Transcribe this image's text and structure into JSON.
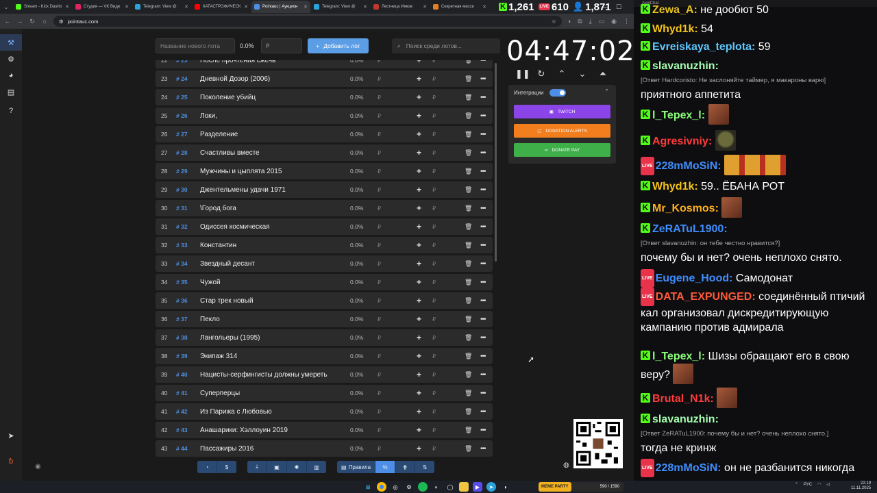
{
  "browser": {
    "tabs": [
      {
        "label": "Stream - Kick Dashb",
        "color": "#53fc18",
        "active": false
      },
      {
        "label": "Студия — VK Виде",
        "color": "#e0245e",
        "active": false
      },
      {
        "label": "Telegram: View @",
        "color": "#2aa3dc",
        "active": false
      },
      {
        "label": "КАТАСТРОФИЧЕСК",
        "color": "#ff0000",
        "active": false
      },
      {
        "label": "Pointauc | Аукцион",
        "color": "#4d8fe6",
        "active": true
      },
      {
        "label": "Telegram: View @",
        "color": "#2aa3dc",
        "active": false
      },
      {
        "label": "Лестница Ияков",
        "color": "#c0392b",
        "active": false
      },
      {
        "label": "Секретная мисси",
        "color": "#e67e22",
        "active": false
      }
    ],
    "url": "pointauc.com"
  },
  "stream_stats": {
    "kick_viewers": "1,261",
    "vk_viewers": "610",
    "followers": "1,871"
  },
  "toolbar": {
    "lot_placeholder": "Название нового лота",
    "percent": "0.0%",
    "amount_placeholder": "₽",
    "add_label": "Добавить лот",
    "search_placeholder": "Поиск среди лотов..."
  },
  "lots": [
    {
      "idx": "22",
      "num": "# 23",
      "title": "После прочтения сжечь",
      "pct": "0.0%"
    },
    {
      "idx": "23",
      "num": "# 24",
      "title": "Дневной Дозор (2006)",
      "pct": "0.0%"
    },
    {
      "idx": "24",
      "num": "# 25",
      "title": "Поколение убийц",
      "pct": "0.0%"
    },
    {
      "idx": "25",
      "num": "# 26",
      "title": "Локи,",
      "pct": "0.0%"
    },
    {
      "idx": "26",
      "num": "# 27",
      "title": "Разделение",
      "pct": "0.0%"
    },
    {
      "idx": "27",
      "num": "# 28",
      "title": "Счастливы вместе",
      "pct": "0.0%"
    },
    {
      "idx": "28",
      "num": "# 29",
      "title": "Мужчины и цыплята 2015",
      "pct": "0.0%"
    },
    {
      "idx": "29",
      "num": "# 30",
      "title": "Джентельмены удачи 1971",
      "pct": "0.0%"
    },
    {
      "idx": "30",
      "num": "# 31",
      "title": "\\Город бога",
      "pct": "0.0%"
    },
    {
      "idx": "31",
      "num": "# 32",
      "title": "Одиссея космическая",
      "pct": "0.0%"
    },
    {
      "idx": "32",
      "num": "# 33",
      "title": "Константин",
      "pct": "0.0%"
    },
    {
      "idx": "33",
      "num": "# 34",
      "title": "Звездный десант",
      "pct": "0.0%"
    },
    {
      "idx": "34",
      "num": "# 35",
      "title": "Чужой",
      "pct": "0.0%"
    },
    {
      "idx": "35",
      "num": "# 36",
      "title": "Стар трек новый",
      "pct": "0.0%"
    },
    {
      "idx": "36",
      "num": "# 37",
      "title": "Пекло",
      "pct": "0.0%"
    },
    {
      "idx": "37",
      "num": "# 38",
      "title": "Лангольеры (1995)",
      "pct": "0.0%"
    },
    {
      "idx": "38",
      "num": "# 39",
      "title": "Экипаж 314",
      "pct": "0.0%"
    },
    {
      "idx": "39",
      "num": "# 40",
      "title": "Нацисты-серфингисты должны умереть",
      "pct": "0.0%"
    },
    {
      "idx": "40",
      "num": "# 41",
      "title": "Суперперцы",
      "pct": "0.0%"
    },
    {
      "idx": "41",
      "num": "# 42",
      "title": "Из Парижа с Любовью",
      "pct": "0.0%"
    },
    {
      "idx": "42",
      "num": "# 43",
      "title": "Анашарики: Хэллоуин 2019",
      "pct": "0.0%"
    },
    {
      "idx": "43",
      "num": "# 44",
      "title": "Пассажиры 2016",
      "pct": "0.0%"
    }
  ],
  "currency_symbol": "₽",
  "timer": {
    "display": "04:47:02"
  },
  "integrations": {
    "label": "Интеграции",
    "enabled": true,
    "twitch_label": "TWITCH",
    "donation_alerts_label": "DONATION ALERTS",
    "donate_pay_label": "DONATE PAY"
  },
  "bottom_bar": {
    "rules_label": "Правила",
    "percent_label": "%"
  },
  "taskbar": {
    "memeparty_label": "MEME PARTY",
    "memeparty_count": "590 / 1590",
    "lang": "РУС",
    "time": "22:19",
    "date": "11.11.2025"
  },
  "chat": {
    "window_title": "AxelChat",
    "messages": [
      {
        "badge": "kick",
        "user": "Zewa_A",
        "color": "#e5c11f",
        "text": "не дообют 50"
      },
      {
        "badge": "kick",
        "user": "Whyd1k",
        "color": "#f5c518",
        "text": "54"
      },
      {
        "badge": "kick",
        "user": "Evreiskaya_teplota",
        "color": "#5fc8ff",
        "text": "59"
      },
      {
        "badge": "kick",
        "user": "slavanuzhin",
        "color": "#a5ffb0",
        "text": "",
        "reply": "[Ответ Hardcoristo: Не заслоняйте таймер, я макароны варю]",
        "line2": "приятного аппетита"
      },
      {
        "badge": "kick",
        "user": "l_Tepex_l",
        "color": "#8bff7a",
        "text": ""
      },
      {
        "badge": "kick",
        "user": "Agresivniy",
        "color": "#ff3b3b",
        "text": ""
      },
      {
        "badge": "vk",
        "user": "228mMoSiN",
        "color": "#3f8eff",
        "text": ""
      },
      {
        "badge": "kick",
        "user": "Whyd1k",
        "color": "#f5c518",
        "text": "59.. ЁБАНА РОТ"
      },
      {
        "badge": "kick",
        "user": "Mr_Kosmos",
        "color": "#ffb020",
        "text": ""
      },
      {
        "badge": "kick",
        "user": "ZeRATuL1900",
        "color": "#3f8eff",
        "text": "",
        "reply": "[Ответ slavanuzhin: он тебе честно нравится?]",
        "line2": "почему бы и нет? очень неплохо снято."
      },
      {
        "badge": "vk",
        "user": "Eugene_Hood",
        "color": "#3f8eff",
        "text": "Самодонат"
      },
      {
        "badge": "vk",
        "user": "DATA_EXPUNGED",
        "color": "#ff5a3a",
        "text": "соединённый птичий кал организовал дискредитирующую кампанию против адмирала"
      },
      {
        "badge": "kick",
        "user": "l_Tepex_l",
        "color": "#8bff7a",
        "text": "Шизы обращают его в свою веру?"
      },
      {
        "badge": "kick",
        "user": "Brutal_N1k",
        "color": "#ff3b3b",
        "text": ""
      },
      {
        "badge": "kick",
        "user": "slavanuzhin",
        "color": "#a5ffb0",
        "text": "",
        "reply": "[Ответ ZeRATuL1900: почему бы и нет? очень неплохо снято.]",
        "line2": "тогда не кринж"
      },
      {
        "badge": "vk",
        "user": "228mMoSiN",
        "color": "#3f8eff",
        "text": "он не разбанится никогда"
      }
    ]
  }
}
